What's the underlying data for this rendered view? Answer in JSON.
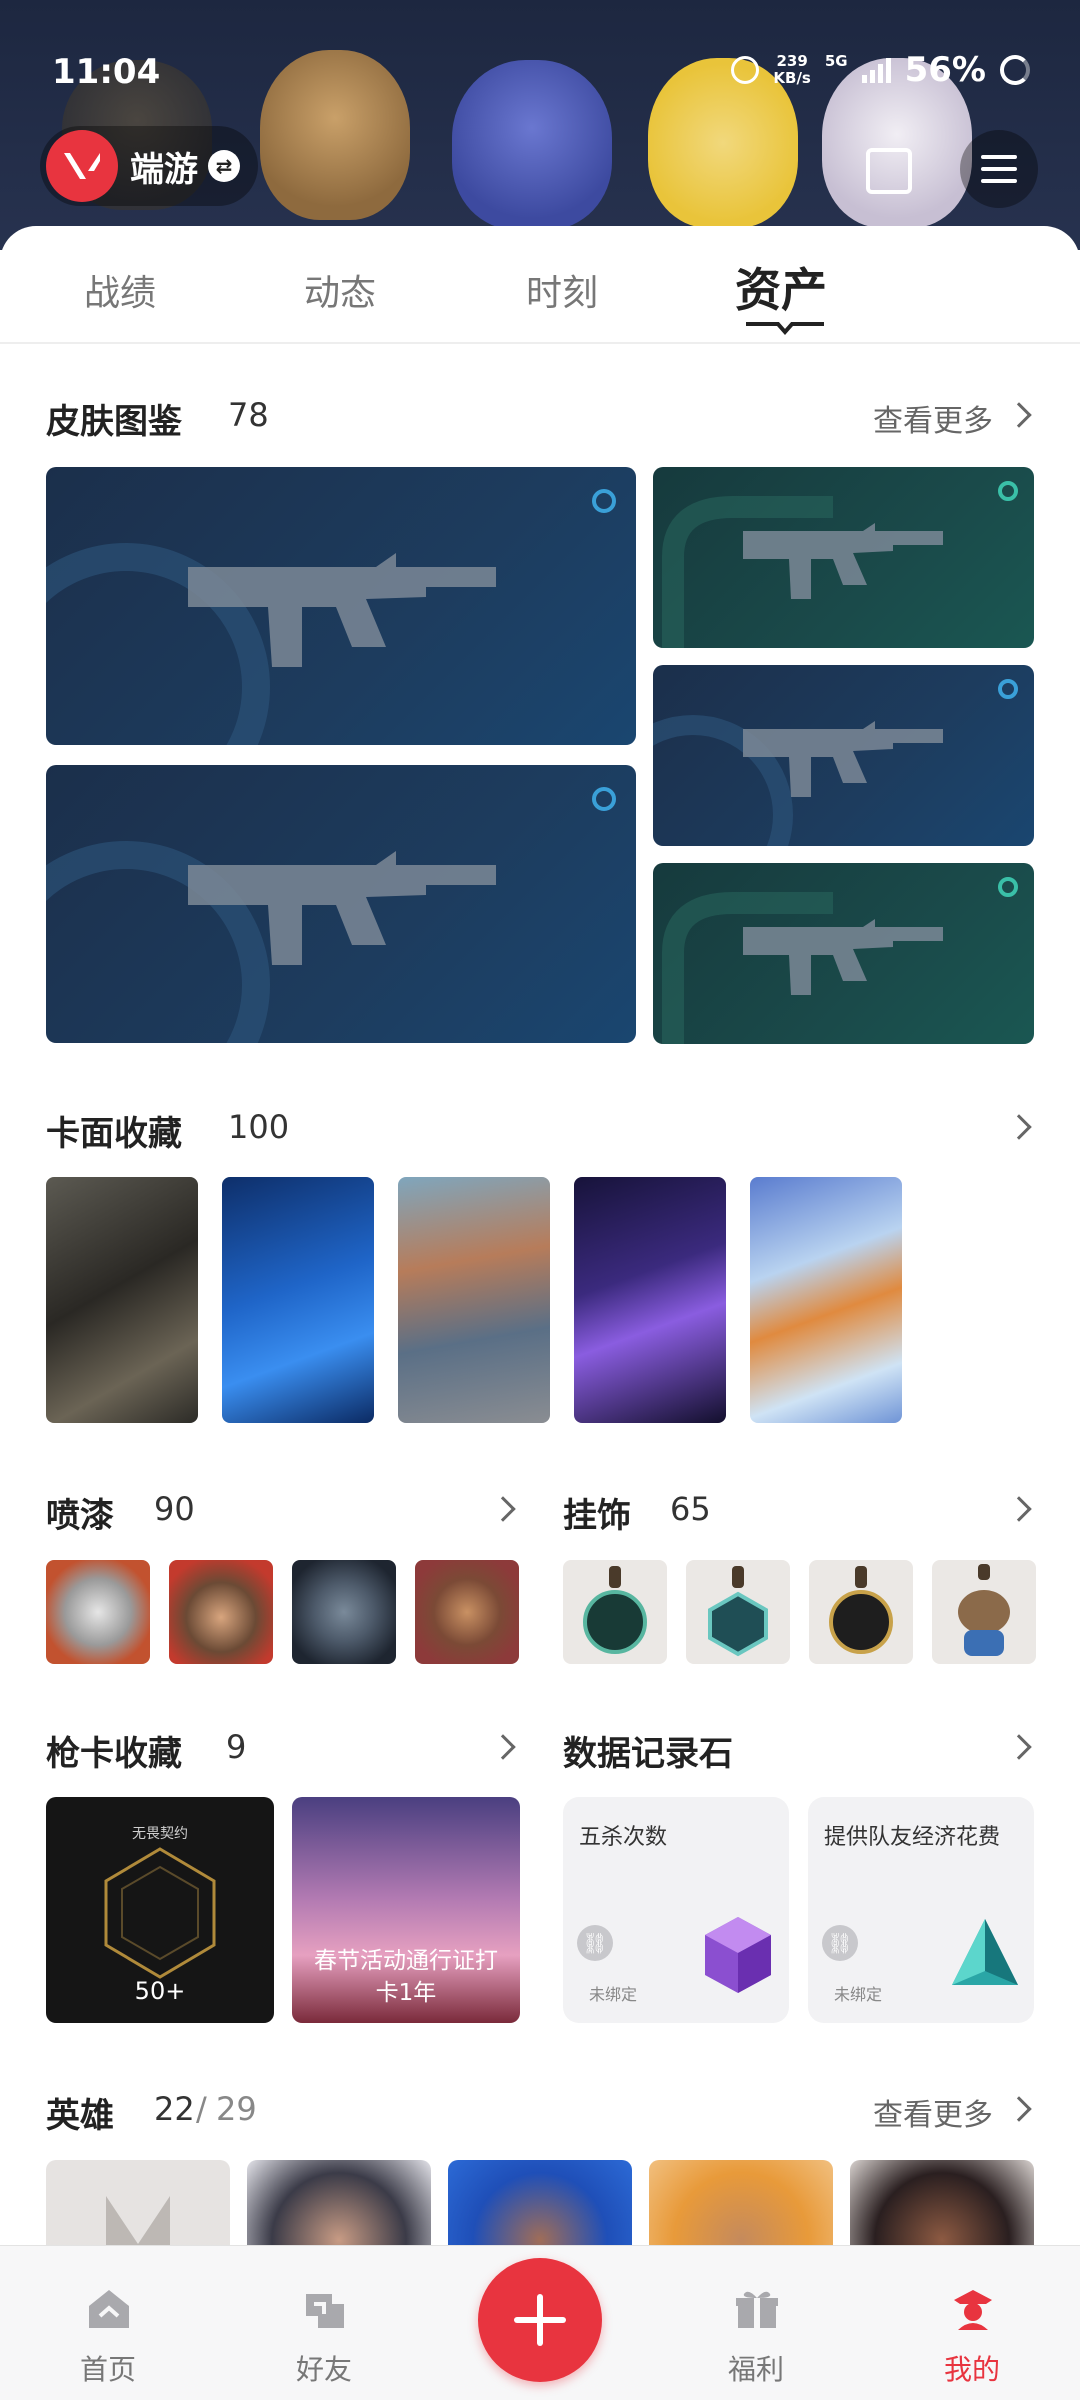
{
  "status_bar": {
    "time": "11:04",
    "speed_value": "239",
    "speed_unit": "KB/s",
    "network": "5G",
    "battery": "56%"
  },
  "header": {
    "brand_name": "端游"
  },
  "tabs": [
    {
      "label": "战绩",
      "active": false
    },
    {
      "label": "动态",
      "active": false
    },
    {
      "label": "时刻",
      "active": false
    },
    {
      "label": "资产",
      "active": true
    }
  ],
  "skins": {
    "title": "皮肤图鉴",
    "count": "78",
    "more_label": "查看更多"
  },
  "cards": {
    "title": "卡面收藏",
    "count": "100"
  },
  "sprays": {
    "title": "喷漆",
    "count": "90"
  },
  "charms": {
    "title": "挂饰",
    "count": "65"
  },
  "gun_cards": {
    "title": "枪卡收藏",
    "count": "9",
    "items": [
      {
        "brand": "无畏契约",
        "label": "50+"
      },
      {
        "label_line1": "春节活动通行证打",
        "label_line2": "卡1年"
      }
    ]
  },
  "data_stones": {
    "title": "数据记录石",
    "items": [
      {
        "title": "五杀次数",
        "status": "未绑定"
      },
      {
        "title": "提供队友经济花费",
        "status": "未绑定"
      }
    ]
  },
  "heroes": {
    "title": "英雄",
    "owned": "22",
    "separator": "/",
    "total": "29",
    "more_label": "查看更多"
  },
  "bottom_nav": [
    {
      "label": "首页",
      "icon": "home-icon",
      "active": false
    },
    {
      "label": "好友",
      "icon": "friends-icon",
      "active": false
    },
    {
      "label": "福利",
      "icon": "gift-icon",
      "active": false
    },
    {
      "label": "我的",
      "icon": "profile-icon",
      "active": true
    }
  ],
  "colors": {
    "accent": "#e8343f",
    "header_bg": "#1d2740",
    "skin_blue": "#1d3c5e",
    "skin_green": "#1a4a4a"
  }
}
